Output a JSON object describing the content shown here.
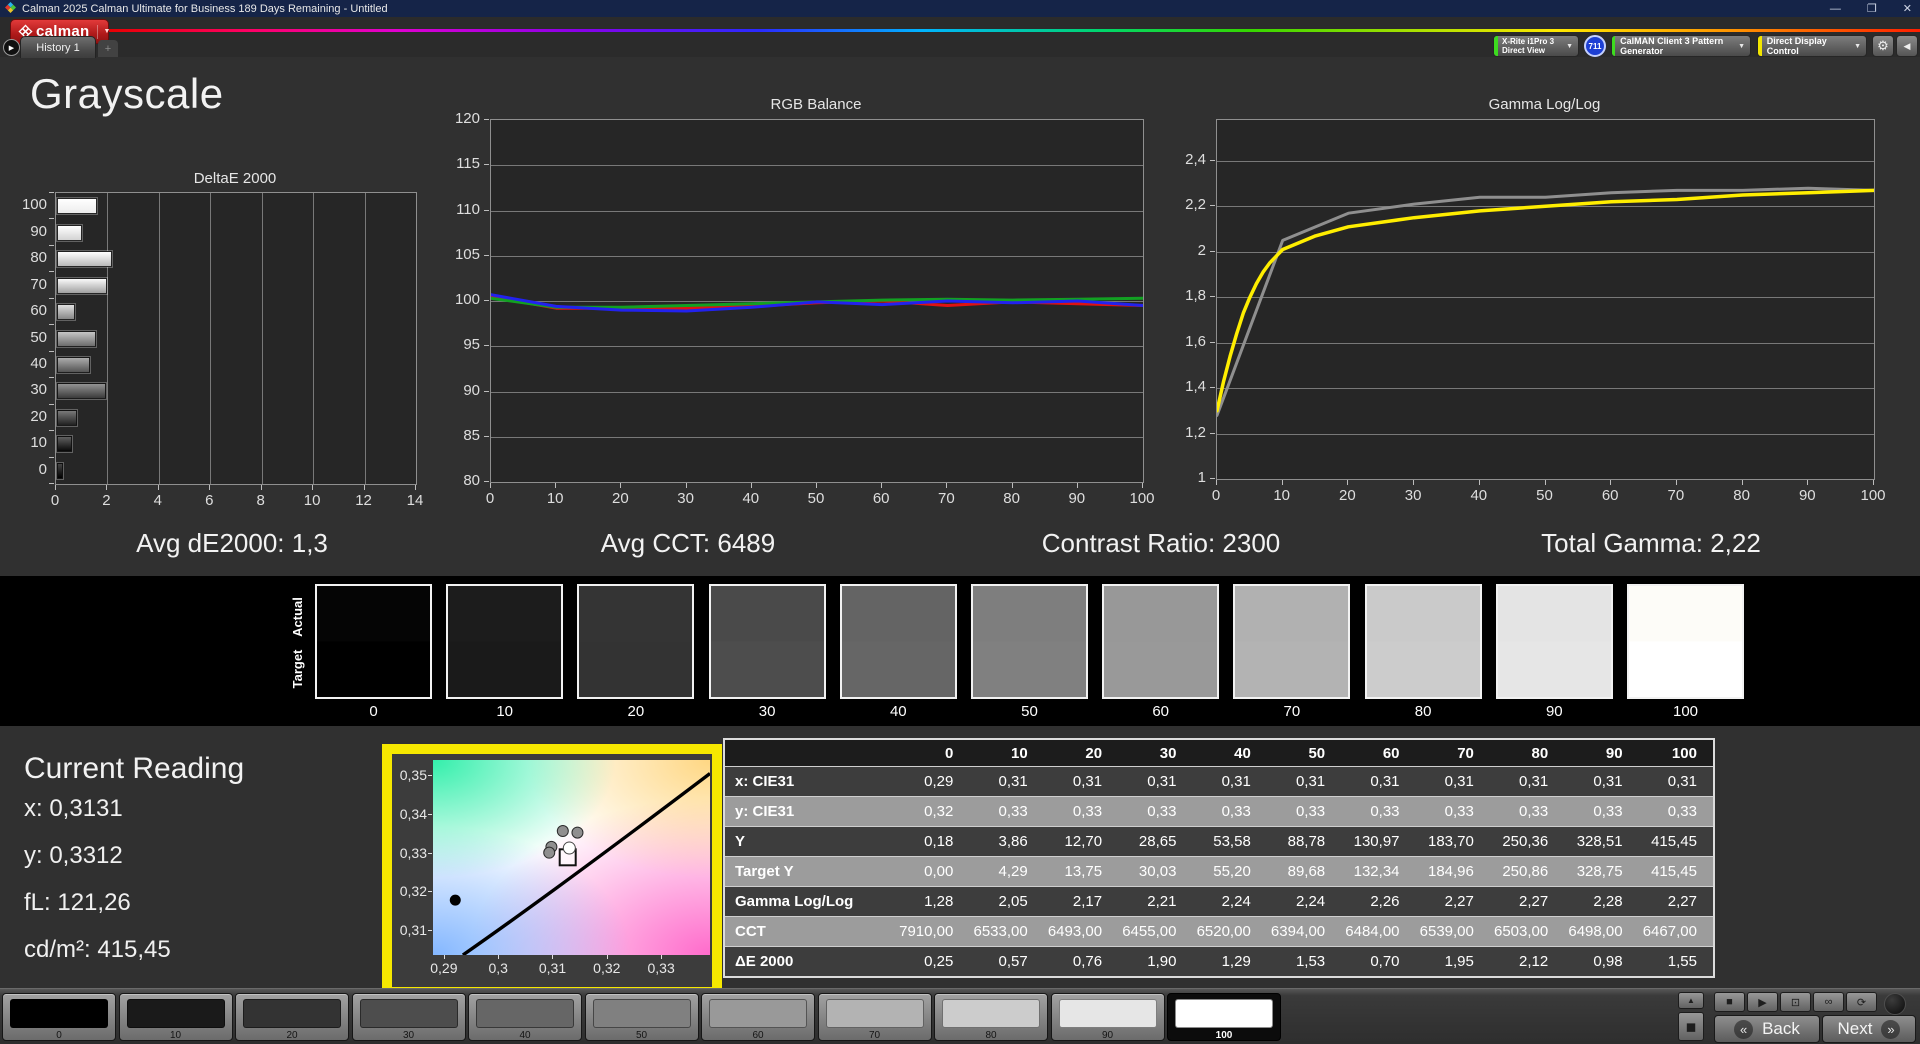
{
  "window": {
    "title": "Calman 2025 Calman Ultimate for Business 189 Days Remaining  - Untitled",
    "minimize": "—",
    "maximize": "❐",
    "close": "✕"
  },
  "header": {
    "logo_text": "calman",
    "caret": "▼",
    "arrow": "▶",
    "tab": "History 1",
    "plus": "+",
    "meter": {
      "line1": "X-Rite i1Pro 3",
      "line2": "Direct View",
      "badge": "711",
      "accent": "#3ddb1f"
    },
    "pattern": {
      "label": "CalMAN Client 3 Pattern Generator",
      "accent": "#3ddb1f"
    },
    "display": {
      "label": "Direct Display Control",
      "accent": "#f3e600"
    },
    "gear_icon": "⚙",
    "collapse_icon": "◀"
  },
  "page": {
    "heading": "Grayscale"
  },
  "stats": {
    "de": "Avg dE2000: 1,3",
    "cct": "Avg CCT: 6489",
    "contrast": "Contrast Ratio: 2300",
    "gamma": "Total Gamma: 2,22"
  },
  "chart_data": [
    {
      "type": "bar",
      "title": "DeltaE 2000",
      "orientation": "horizontal",
      "categories": [
        "100",
        "90",
        "80",
        "70",
        "60",
        "50",
        "40",
        "30",
        "20",
        "10",
        "0"
      ],
      "values": [
        1.55,
        0.98,
        2.12,
        1.95,
        0.7,
        1.53,
        1.29,
        1.9,
        0.76,
        0.57,
        0.25
      ],
      "xlim": [
        0,
        14
      ],
      "xtick_labels": [
        "0",
        "2",
        "4",
        "6",
        "8",
        "10",
        "12",
        "14"
      ],
      "xtick_values": [
        0,
        2,
        4,
        6,
        8,
        10,
        12,
        14
      ],
      "note": "bar fill shade equals grayscale stimulus level"
    },
    {
      "type": "line",
      "title": "RGB Balance",
      "x": [
        0,
        10,
        20,
        30,
        40,
        50,
        60,
        70,
        80,
        90,
        100
      ],
      "xtick_labels": [
        "0",
        "10",
        "20",
        "30",
        "40",
        "50",
        "60",
        "70",
        "80",
        "90",
        "100"
      ],
      "ylim": [
        80,
        120
      ],
      "ytick_labels": [
        "120",
        "115",
        "110",
        "105",
        "100",
        "95",
        "90",
        "85",
        "80"
      ],
      "ytick_values": [
        120,
        115,
        110,
        105,
        100,
        95,
        90,
        85,
        80
      ],
      "series": [
        {
          "name": "red-balance",
          "color": "#e01212",
          "values": [
            100.5,
            99.2,
            99.2,
            99.2,
            99.4,
            99.8,
            100.0,
            99.5,
            99.9,
            99.7,
            99.5
          ]
        },
        {
          "name": "green-balance",
          "color": "#12a022",
          "values": [
            100.3,
            99.3,
            99.3,
            99.5,
            99.7,
            99.9,
            100.1,
            100.2,
            100.1,
            100.2,
            100.3
          ]
        },
        {
          "name": "blue-balance",
          "color": "#2222ee",
          "values": [
            100.7,
            99.4,
            99.0,
            98.9,
            99.3,
            99.9,
            99.6,
            100.0,
            99.8,
            100.0,
            99.5
          ]
        }
      ]
    },
    {
      "type": "line",
      "title": "Gamma Log/Log",
      "x": [
        0,
        10,
        20,
        30,
        40,
        50,
        60,
        70,
        80,
        90,
        100
      ],
      "xtick_labels": [
        "0",
        "10",
        "20",
        "30",
        "40",
        "50",
        "60",
        "70",
        "80",
        "90",
        "100"
      ],
      "ylim": [
        1,
        2.58
      ],
      "ytick_labels": [
        "2,4",
        "2,2",
        "2",
        "1,8",
        "1,6",
        "1,4",
        "1,2",
        "1"
      ],
      "ytick_values": [
        2.4,
        2.2,
        2.0,
        1.8,
        1.6,
        1.4,
        1.2,
        1.0
      ],
      "series": [
        {
          "name": "target-gamma",
          "color": "#ffee00",
          "x": [
            0,
            1,
            2,
            3,
            4,
            5,
            6,
            7,
            8,
            9,
            10,
            15,
            20,
            30,
            40,
            50,
            60,
            70,
            80,
            90,
            100
          ],
          "values": [
            1.3,
            1.43,
            1.54,
            1.64,
            1.73,
            1.8,
            1.86,
            1.91,
            1.95,
            1.98,
            2.01,
            2.07,
            2.11,
            2.15,
            2.18,
            2.2,
            2.22,
            2.23,
            2.25,
            2.26,
            2.27
          ]
        },
        {
          "name": "measured-gamma",
          "color": "#8f8f8f",
          "x": [
            0,
            10,
            20,
            30,
            40,
            50,
            60,
            70,
            80,
            90,
            100
          ],
          "values": [
            1.28,
            2.05,
            2.17,
            2.21,
            2.24,
            2.24,
            2.26,
            2.27,
            2.27,
            2.28,
            2.27
          ]
        }
      ]
    },
    {
      "type": "scatter",
      "title": "CIE chromaticity detail",
      "xlim": [
        0.288,
        0.339
      ],
      "ylim": [
        0.3035,
        0.354
      ],
      "xtick_labels": [
        "0,29",
        "0,3",
        "0,31",
        "0,32",
        "0,33"
      ],
      "xtick_values": [
        0.29,
        0.3,
        0.31,
        0.32,
        0.33
      ],
      "ytick_labels": [
        "0,35",
        "0,34",
        "0,33",
        "0,32",
        "0,31"
      ],
      "ytick_values": [
        0.35,
        0.34,
        0.33,
        0.32,
        0.31
      ],
      "points": [
        {
          "x": 0.3119,
          "y": 0.3356,
          "type": "measure"
        },
        {
          "x": 0.3146,
          "y": 0.3352,
          "type": "measure"
        },
        {
          "x": 0.3098,
          "y": 0.3315,
          "type": "measure"
        },
        {
          "x": 0.3094,
          "y": 0.33,
          "type": "measure"
        },
        {
          "x": 0.3128,
          "y": 0.3288,
          "type": "target-square"
        },
        {
          "x": 0.3131,
          "y": 0.3312,
          "type": "current"
        },
        {
          "x": 0.2921,
          "y": 0.3177,
          "type": "black-dot"
        }
      ],
      "locus": [
        [
          0.2935,
          0.3035
        ],
        [
          0.3135,
          0.3237
        ],
        [
          0.339,
          0.3505
        ]
      ]
    }
  ],
  "swatch_strip": {
    "row_labels": [
      "Actual",
      "Target"
    ],
    "levels": [
      {
        "label": "0",
        "actual": "#050505",
        "target": "#000000"
      },
      {
        "label": "10",
        "actual": "#1c1c1c",
        "target": "#1a1a1a"
      },
      {
        "label": "20",
        "actual": "#343434",
        "target": "#333333"
      },
      {
        "label": "30",
        "actual": "#4a4a4a",
        "target": "#4d4d4d"
      },
      {
        "label": "40",
        "actual": "#646464",
        "target": "#666666"
      },
      {
        "label": "50",
        "actual": "#7e7e7e",
        "target": "#808080"
      },
      {
        "label": "60",
        "actual": "#989898",
        "target": "#999999"
      },
      {
        "label": "70",
        "actual": "#b1b1b1",
        "target": "#b3b3b3"
      },
      {
        "label": "80",
        "actual": "#cacaca",
        "target": "#cccccc"
      },
      {
        "label": "90",
        "actual": "#e4e4e4",
        "target": "#e6e6e6"
      },
      {
        "label": "100",
        "actual": "#fdfcf8",
        "target": "#ffffff"
      }
    ]
  },
  "current_reading": {
    "title": "Current Reading",
    "x": "x: 0,3131",
    "y": "y: 0,3312",
    "fl": "fL: 121,26",
    "cdm2": "cd/m²: 415,45"
  },
  "table": {
    "col_headers": [
      "0",
      "10",
      "20",
      "30",
      "40",
      "50",
      "60",
      "70",
      "80",
      "90",
      "100"
    ],
    "rows": [
      {
        "label": "x: CIE31",
        "shade": "dark",
        "values": [
          "0,29",
          "0,31",
          "0,31",
          "0,31",
          "0,31",
          "0,31",
          "0,31",
          "0,31",
          "0,31",
          "0,31",
          "0,31"
        ]
      },
      {
        "label": "y: CIE31",
        "shade": "light",
        "values": [
          "0,32",
          "0,33",
          "0,33",
          "0,33",
          "0,33",
          "0,33",
          "0,33",
          "0,33",
          "0,33",
          "0,33",
          "0,33"
        ]
      },
      {
        "label": "Y",
        "shade": "dark",
        "values": [
          "0,18",
          "3,86",
          "12,70",
          "28,65",
          "53,58",
          "88,78",
          "130,97",
          "183,70",
          "250,36",
          "328,51",
          "415,45"
        ]
      },
      {
        "label": "Target Y",
        "shade": "light",
        "values": [
          "0,00",
          "4,29",
          "13,75",
          "30,03",
          "55,20",
          "89,68",
          "132,34",
          "184,96",
          "250,86",
          "328,75",
          "415,45"
        ]
      },
      {
        "label": "Gamma Log/Log",
        "shade": "dark",
        "values": [
          "1,28",
          "2,05",
          "2,17",
          "2,21",
          "2,24",
          "2,24",
          "2,26",
          "2,27",
          "2,27",
          "2,28",
          "2,27"
        ]
      },
      {
        "label": "CCT",
        "shade": "light",
        "values": [
          "7910,00",
          "6533,00",
          "6493,00",
          "6455,00",
          "6520,00",
          "6394,00",
          "6484,00",
          "6539,00",
          "6503,00",
          "6498,00",
          "6467,00"
        ]
      },
      {
        "label": "ΔE 2000",
        "shade": "dark",
        "values": [
          "0,25",
          "0,57",
          "0,76",
          "1,90",
          "1,29",
          "1,53",
          "0,70",
          "1,95",
          "2,12",
          "0,98",
          "1,55"
        ]
      }
    ]
  },
  "bottom_bar": {
    "selected": "100",
    "levels": [
      {
        "label": "0",
        "color": "#000000"
      },
      {
        "label": "10",
        "color": "#1a1a1a"
      },
      {
        "label": "20",
        "color": "#333333"
      },
      {
        "label": "30",
        "color": "#4d4d4d"
      },
      {
        "label": "40",
        "color": "#666666"
      },
      {
        "label": "50",
        "color": "#808080"
      },
      {
        "label": "60",
        "color": "#999999"
      },
      {
        "label": "70",
        "color": "#b3b3b3"
      },
      {
        "label": "80",
        "color": "#cccccc"
      },
      {
        "label": "90",
        "color": "#e6e6e6"
      },
      {
        "label": "100",
        "color": "#ffffff"
      }
    ],
    "controls": {
      "up": "▲",
      "screen": "◼",
      "transport": [
        {
          "name": "stop",
          "glyph": "■"
        },
        {
          "name": "play",
          "glyph": "▶"
        },
        {
          "name": "pattern-window",
          "glyph": "⊡"
        },
        {
          "name": "continuous",
          "glyph": "∞"
        },
        {
          "name": "repeat",
          "glyph": "⟳"
        }
      ],
      "back_chevron": "«",
      "back_label": "Back",
      "next_label": "Next",
      "next_chevron": "»"
    }
  }
}
